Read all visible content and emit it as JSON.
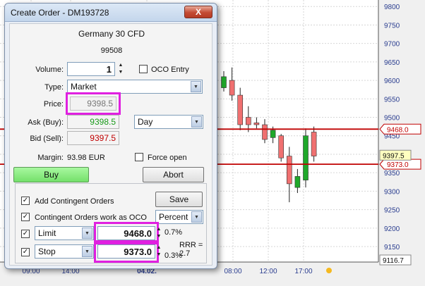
{
  "dialog": {
    "title": "Create Order - DM193728",
    "close_label": "X",
    "instrument": "Germany 30 CFD",
    "instrument_code": "99508",
    "volume_label": "Volume:",
    "volume_value": "1",
    "oco_entry_label": "OCO Entry",
    "type_label": "Type:",
    "type_value": "Market",
    "price_label": "Price:",
    "price_value": "9398.5",
    "ask_label": "Ask (Buy):",
    "ask_value": "9398.5",
    "bid_label": "Bid (Sell):",
    "bid_value": "9397.5",
    "validity_value": "Day",
    "margin_label": "Margin:",
    "margin_value": "93.98 EUR",
    "force_open_label": "Force open",
    "buy_label": "Buy",
    "abort_label": "Abort",
    "add_contingent_label": "Add Contingent Orders",
    "save_label": "Save",
    "contingent_oco_label": "Contingent Orders work as OCO",
    "percent_value": "Percent",
    "limit_type": "Limit",
    "limit_value": "9468.0",
    "limit_pct": "0.7%",
    "stop_type": "Stop",
    "stop_value": "9373.0",
    "stop_pct": "0.3%",
    "rrr": "RRR = 2.7"
  },
  "colors": {
    "highlight": "#e020e0",
    "level_line": "#c00000",
    "candle_up": "#1fa82a",
    "candle_down": "#f07070",
    "buy_button": "#90f088",
    "ask_text": "#1a9a1a",
    "bid_text": "#c00000"
  },
  "chart_data": {
    "type": "candlestick",
    "y_ticks": [
      "9800",
      "9750",
      "9700",
      "9650",
      "9600",
      "9550",
      "9500",
      "9450",
      "9400",
      "9350",
      "9300",
      "9250",
      "9200",
      "9150"
    ],
    "x_ticks": [
      "09:00",
      "14:00",
      "04.02.",
      "08:00",
      "12:00",
      "17:00"
    ],
    "level_labels": [
      "9468.0",
      "9373.0"
    ],
    "current_price": "9397.5",
    "low_value": "9116.7",
    "ylim": [
      9110,
      9810
    ],
    "candles": [
      {
        "open": 9580,
        "close": 9610,
        "high": 9625,
        "low": 9570
      },
      {
        "open": 9600,
        "close": 9560,
        "high": 9635,
        "low": 9545
      },
      {
        "open": 9560,
        "close": 9480,
        "high": 9580,
        "low": 9465
      },
      {
        "open": 9500,
        "close": 9480,
        "high": 9530,
        "low": 9460
      },
      {
        "open": 9485,
        "close": 9480,
        "high": 9500,
        "low": 9470
      },
      {
        "open": 9480,
        "close": 9440,
        "high": 9495,
        "low": 9430
      },
      {
        "open": 9445,
        "close": 9465,
        "high": 9475,
        "low": 9430
      },
      {
        "open": 9450,
        "close": 9390,
        "high": 9455,
        "low": 9380
      },
      {
        "open": 9395,
        "close": 9320,
        "high": 9420,
        "low": 9270
      },
      {
        "open": 9310,
        "close": 9340,
        "high": 9360,
        "low": 9295
      },
      {
        "open": 9330,
        "close": 9450,
        "high": 9470,
        "low": 9310
      },
      {
        "open": 9460,
        "close": 9395,
        "high": 9475,
        "low": 9380
      }
    ]
  }
}
